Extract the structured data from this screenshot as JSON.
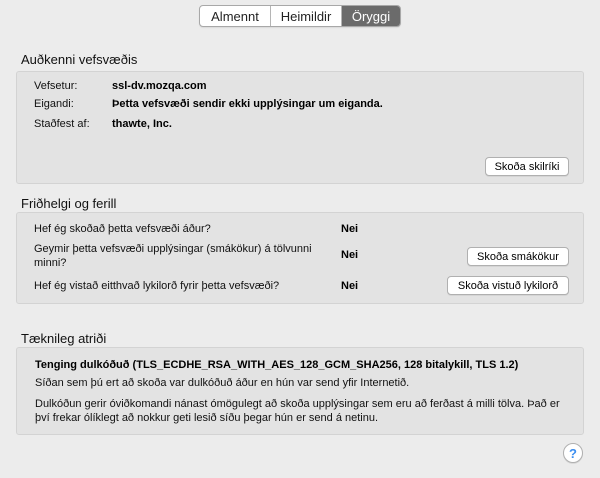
{
  "tabs": [
    {
      "label": "Almennt",
      "active": false
    },
    {
      "label": "Heimildir",
      "active": false
    },
    {
      "label": "Öryggi",
      "active": true
    }
  ],
  "identity": {
    "title": "Auðkenni vefsvæðis",
    "website_label": "Vefsetur:",
    "website_value": "ssl-dv.mozqa.com",
    "owner_label": "Eigandi:",
    "owner_value": "Þetta vefsvæði sendir ekki upplýsingar um eiganda.",
    "verified_label": "Staðfest af:",
    "verified_value": "thawte, Inc.",
    "view_cert_button": "Skoða skilríki"
  },
  "privacy": {
    "title": "Friðhelgi og ferill",
    "q1": "Hef ég skoðað þetta vefsvæði áður?",
    "a1": "Nei",
    "q2": "Geymir þetta vefsvæði upplýsingar (smákökur) á tölvunni minni?",
    "a2": "Nei",
    "cookies_button": "Skoða smákökur",
    "q3": "Hef ég vistað eitthvað lykilorð fyrir þetta vefsvæði?",
    "a3": "Nei",
    "passwords_button": "Skoða vistuð lykilorð"
  },
  "technical": {
    "title": "Tæknileg atriði",
    "connection": "Tenging dulkóðuð (TLS_ECDHE_RSA_WITH_AES_128_GCM_SHA256, 128 bitalykill, TLS 1.2)",
    "line1": "Síðan sem þú ert að skoða var dulkóðuð áður en hún var send yfir Internetið.",
    "line2": "Dulkóðun gerir óviðkomandi nánast ómögulegt að skoða upplýsingar sem eru að ferðast á milli tölva. Það er því frekar ólíklegt að nokkur geti lesið síðu þegar hún er send á netinu."
  },
  "help_label": "?",
  "colors": {
    "active_tab": "#6b6b6b",
    "help_icon": "#3b8ef0",
    "group_bg": "#e3e3e3",
    "window_bg": "#ececec"
  }
}
